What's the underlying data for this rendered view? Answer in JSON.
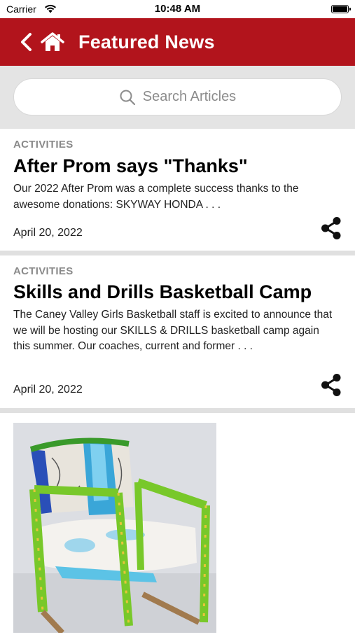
{
  "status_bar": {
    "carrier": "Carrier",
    "time": "10:48 AM"
  },
  "header": {
    "title": "Featured News",
    "back_icon": "chevron-left-icon",
    "home_icon": "home-icon",
    "color": "#b2141c"
  },
  "search": {
    "placeholder": "Search Articles"
  },
  "articles": [
    {
      "category": "ACTIVITIES",
      "title": "After Prom says \"Thanks\"",
      "excerpt": "Our 2022 After Prom was a complete success thanks to the awesome donations:   SKYWAY HONDA . . .",
      "date": "April 20, 2022"
    },
    {
      "category": "ACTIVITIES",
      "title": "Skills and Drills Basketball Camp",
      "excerpt": "  The Caney Valley Girls Basketball staff is excited to announce that we will be hosting our SKILLS & DRILLS basketball camp again this summer. Our coaches, current and former . . .",
      "date": "April 20, 2022"
    }
  ]
}
